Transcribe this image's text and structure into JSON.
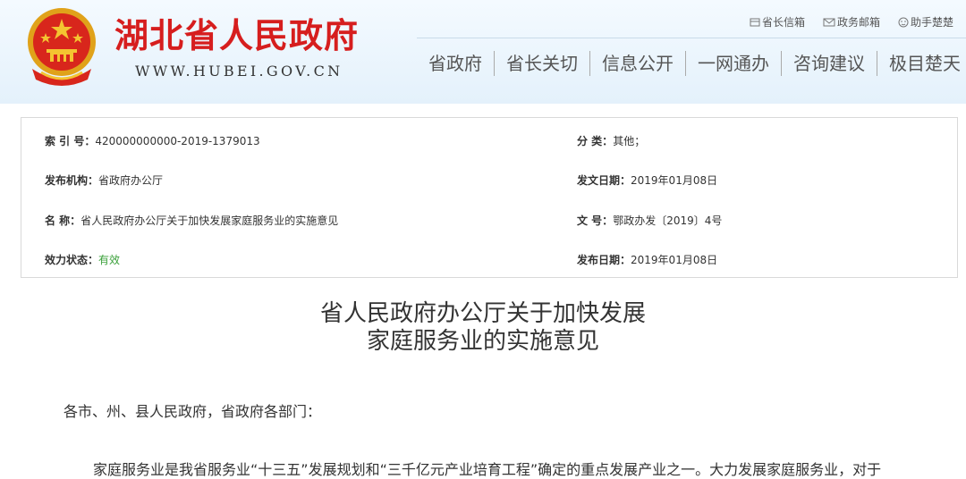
{
  "header": {
    "site_title": "湖北省人民政府",
    "site_url": "WWW.HUBEI.GOV.CN",
    "emblem_icon": "national-emblem-icon",
    "util_links": [
      {
        "label": "省长信箱",
        "icon": "mailbox-icon"
      },
      {
        "label": "政务邮箱",
        "icon": "envelope-icon"
      },
      {
        "label": "助手楚楚",
        "icon": "assistant-icon"
      }
    ],
    "nav": [
      "省政府",
      "省长关切",
      "信息公开",
      "一网通办",
      "咨询建议",
      "极目楚天"
    ],
    "brand_color": "#d61e1e"
  },
  "meta": {
    "index_label": "索 引 号：",
    "index_value": "420000000000-2019-1379013",
    "category_label": "分 类：",
    "category_value": "其他；",
    "issuer_label": "发布机构：",
    "issuer_value": "省政府办公厅",
    "issue_date_label": "发文日期：",
    "issue_date_value": "2019年01月08日",
    "name_label": "名 称：",
    "name_value": "省人民政府办公厅关于加快发展家庭服务业的实施意见",
    "doc_no_label": "文 号：",
    "doc_no_value": "鄂政办发〔2019〕4号",
    "status_label": "效力状态：",
    "status_value": "有效",
    "publish_date_label": "发布日期：",
    "publish_date_value": "2019年01月08日",
    "status_color": "#3aa03a"
  },
  "document": {
    "title_line1": "省人民政府办公厅关于加快发展",
    "title_line2": "家庭服务业的实施意见",
    "salutation": "各市、州、县人民政府，省政府各部门：",
    "paragraph1": "家庭服务业是我省服务业“十三五”发展规划和“三千亿元产业培育工程”确定的重点发展产业之一。大力发展家庭服务业，对于"
  }
}
